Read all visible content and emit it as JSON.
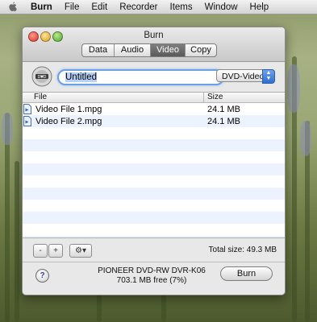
{
  "menubar": {
    "items": [
      "Burn",
      "File",
      "Edit",
      "Recorder",
      "Items",
      "Window",
      "Help"
    ]
  },
  "window": {
    "title": "Burn",
    "tabs": [
      {
        "label": "Data",
        "active": false
      },
      {
        "label": "Audio",
        "active": false
      },
      {
        "label": "Video",
        "active": true
      },
      {
        "label": "Copy",
        "active": false
      }
    ],
    "disc_name": "Untitled",
    "disc_type": "DVD-Video"
  },
  "table": {
    "columns": [
      "File",
      "Size"
    ],
    "rows": [
      {
        "file": "Video File 1.mpg",
        "size": "24.1 MB"
      },
      {
        "file": "Video File 2.mpg",
        "size": "24.1 MB"
      }
    ]
  },
  "controls": {
    "remove_label": "-",
    "add_label": "+",
    "action_label": "⚙▾",
    "total_size": "Total size: 49.3 MB"
  },
  "footer": {
    "help_label": "?",
    "device_name": "PIONEER DVD-RW DVR-K06",
    "device_free": "703.1 MB free (7%)",
    "burn_label": "Burn"
  },
  "colors": {
    "accent": "#3875d7",
    "row_stripe": "#edf3fe",
    "focus_ring": "#6aa0e4"
  }
}
